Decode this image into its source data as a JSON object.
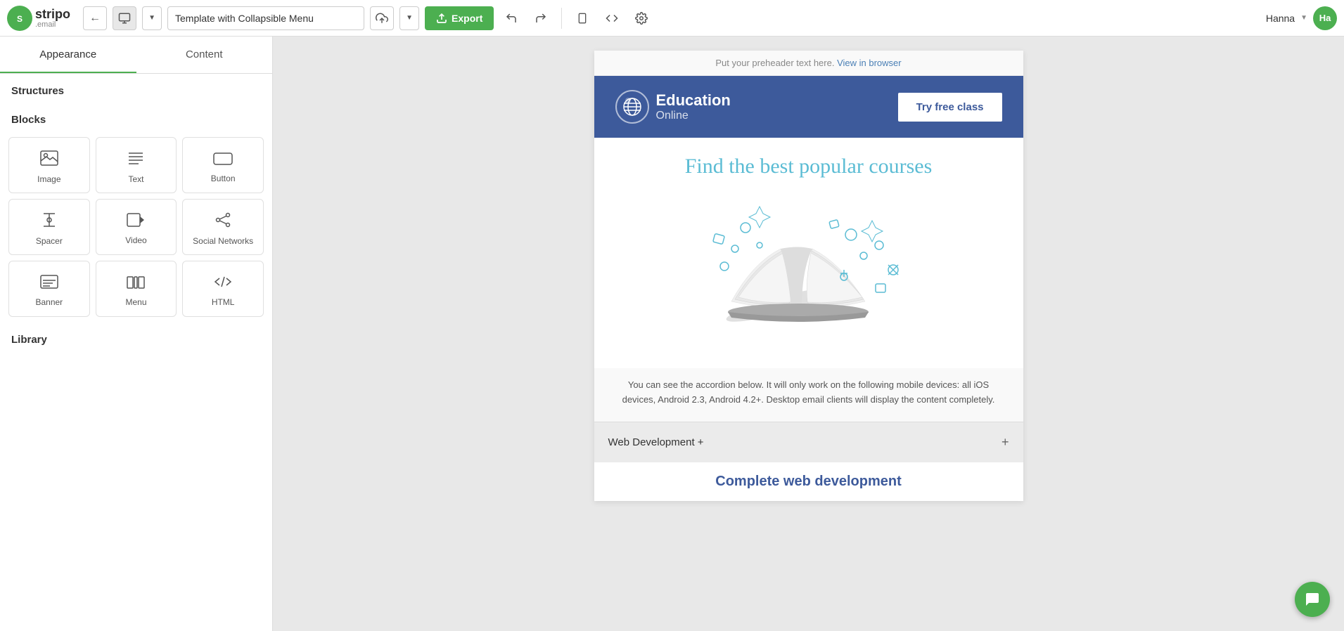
{
  "topbar": {
    "logo_text": "stripo",
    "logo_sub": ".email",
    "template_name": "Template with Collapsible Menu",
    "export_label": "Export",
    "user_name": "Hanna",
    "user_initials": "Ha"
  },
  "sidebar": {
    "tab_appearance": "Appearance",
    "tab_content": "Content",
    "section_structures": "Structures",
    "section_blocks": "Blocks",
    "section_library": "Library",
    "blocks": [
      {
        "id": "image",
        "label": "Image",
        "icon": "🖼"
      },
      {
        "id": "text",
        "label": "Text",
        "icon": "≡"
      },
      {
        "id": "button",
        "label": "Button",
        "icon": "⬜"
      },
      {
        "id": "spacer",
        "label": "Spacer",
        "icon": "⊕"
      },
      {
        "id": "video",
        "label": "Video",
        "icon": "▶"
      },
      {
        "id": "social",
        "label": "Social Networks",
        "icon": "⋖"
      },
      {
        "id": "banner",
        "label": "Banner",
        "icon": "≡"
      },
      {
        "id": "menu",
        "label": "Menu",
        "icon": "⋯"
      },
      {
        "id": "html",
        "label": "HTML",
        "icon": "</>"
      }
    ]
  },
  "email": {
    "preheader_text": "Put your preheader text here.",
    "preheader_link": "View in browser",
    "header_title": "Education",
    "header_subtitle": "Online",
    "try_free_label": "Try free class",
    "find_courses_title": "Find the best popular courses",
    "accordion_text": "You can see the accordion below. It will only work on the following mobile devices: all iOS devices, Android 2.3, Android 4.2+. Desktop email clients will display the content completely.",
    "accordion_item": "Web Development +",
    "complete_web_title": "Complete web development"
  }
}
